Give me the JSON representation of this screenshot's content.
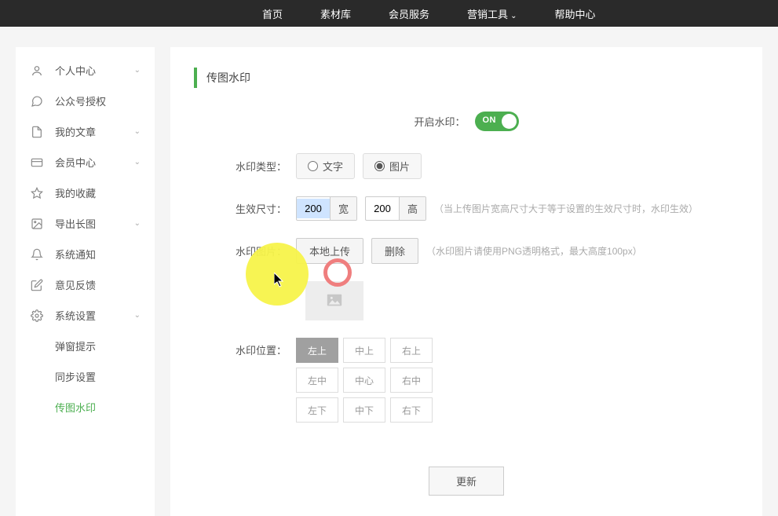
{
  "topnav": {
    "home": "首页",
    "library": "素材库",
    "member": "会员服务",
    "marketing": "营销工具",
    "help": "帮助中心"
  },
  "sidebar": {
    "items": [
      {
        "label": "个人中心",
        "hasArrow": true
      },
      {
        "label": "公众号授权",
        "hasArrow": false
      },
      {
        "label": "我的文章",
        "hasArrow": true
      },
      {
        "label": "会员中心",
        "hasArrow": true
      },
      {
        "label": "我的收藏",
        "hasArrow": false
      },
      {
        "label": "导出长图",
        "hasArrow": true
      },
      {
        "label": "系统通知",
        "hasArrow": false
      },
      {
        "label": "意见反馈",
        "hasArrow": false
      },
      {
        "label": "系统设置",
        "hasArrow": true
      }
    ],
    "subs": [
      {
        "label": "弹窗提示"
      },
      {
        "label": "同步设置"
      },
      {
        "label": "传图水印"
      }
    ]
  },
  "main": {
    "title": "传图水印",
    "toggle_label": "开启水印：",
    "toggle_text": "ON",
    "type_label": "水印类型：",
    "type_text": "文字",
    "type_image": "图片",
    "size_label": "生效尺寸：",
    "size_width": "200",
    "size_width_suffix": "宽",
    "size_height": "200",
    "size_height_suffix": "高",
    "size_hint": "（当上传图片宽高尺寸大于等于设置的生效尺寸时，水印生效）",
    "imgfile_label": "水印图片：",
    "upload_btn": "本地上传",
    "delete_btn": "删除",
    "imgfile_hint": "（水印图片请使用PNG透明格式，最大高度100px）",
    "pos_label": "水印位置：",
    "positions": [
      "左上",
      "中上",
      "右上",
      "左中",
      "中心",
      "右中",
      "左下",
      "中下",
      "右下"
    ],
    "update_btn": "更新"
  }
}
